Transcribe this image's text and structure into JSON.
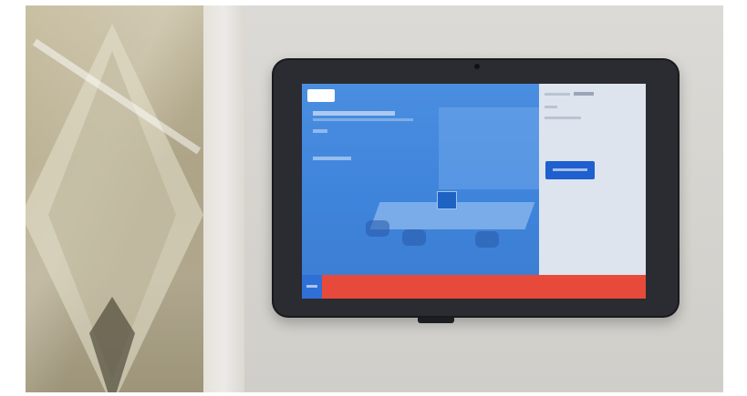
{
  "photo": {
    "subject": "",
    "colors": {
      "screen_blue": "#4b8ee0",
      "side_panel": "#dde4ee",
      "book_button": "#1f5fcf",
      "status_bar": "#e74a3a",
      "tablet_frame": "#2a2c31"
    }
  },
  "icons": {
    "camera": "camera-icon",
    "logo": "brand-logo"
  }
}
